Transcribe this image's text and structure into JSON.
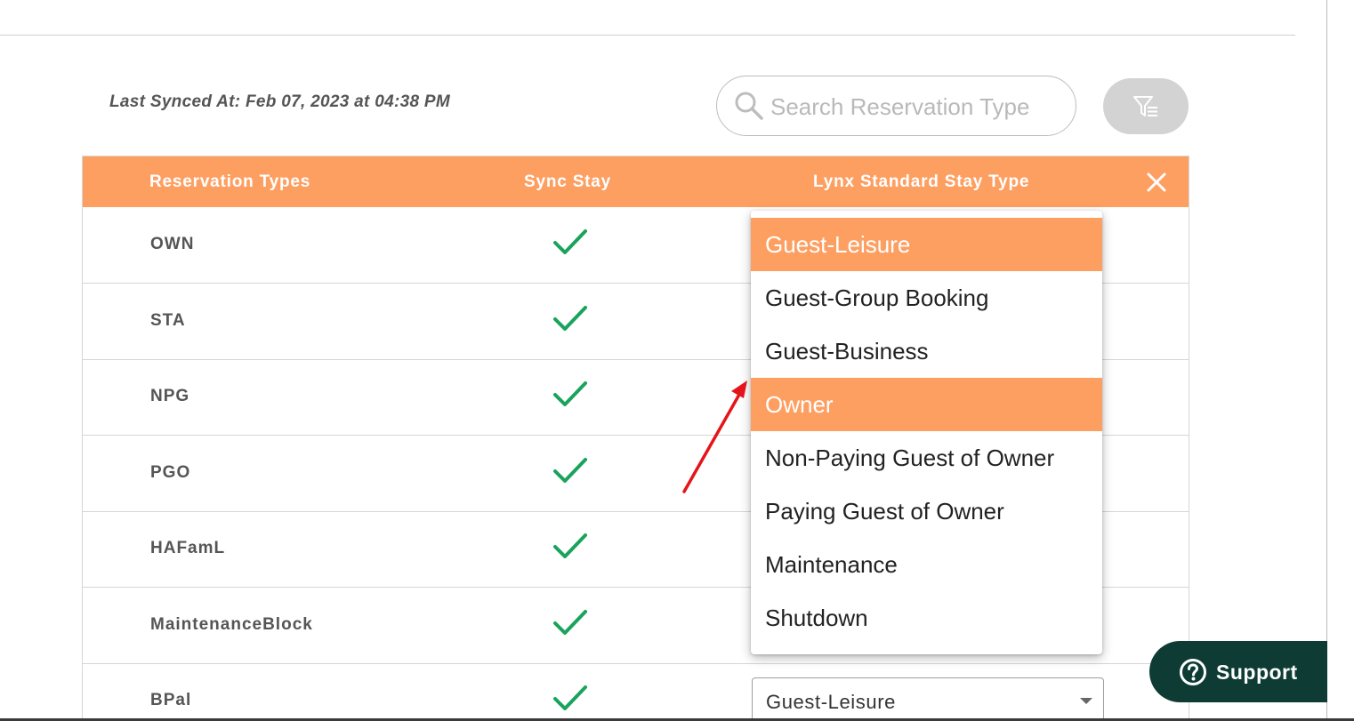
{
  "sync_info": {
    "last_synced": "Last Synced At: Feb 07, 2023 at 04:38 PM"
  },
  "search": {
    "placeholder": "Search Reservation Type",
    "value": ""
  },
  "table": {
    "columns": [
      "Reservation Types",
      "Sync Stay",
      "Lynx Standard Stay Type"
    ],
    "rows": [
      {
        "reservation_type": "OWN",
        "sync_stay": true
      },
      {
        "reservation_type": "STA",
        "sync_stay": true
      },
      {
        "reservation_type": "NPG",
        "sync_stay": true
      },
      {
        "reservation_type": "PGO",
        "sync_stay": true
      },
      {
        "reservation_type": "HAFamL",
        "sync_stay": true
      },
      {
        "reservation_type": "MaintenanceBlock",
        "sync_stay": true
      },
      {
        "reservation_type": "BPal",
        "sync_stay": true,
        "stay_type": "Guest-Leisure"
      }
    ]
  },
  "dropdown": {
    "options": [
      {
        "label": "Guest-Leisure",
        "highlighted": true
      },
      {
        "label": "Guest-Group Booking",
        "highlighted": false
      },
      {
        "label": "Guest-Business",
        "highlighted": false
      },
      {
        "label": "Owner",
        "highlighted": true
      },
      {
        "label": "Non-Paying Guest of Owner",
        "highlighted": false
      },
      {
        "label": "Paying Guest of Owner",
        "highlighted": false
      },
      {
        "label": "Maintenance",
        "highlighted": false
      },
      {
        "label": "Shutdown",
        "highlighted": false
      }
    ]
  },
  "support": {
    "label": "Support"
  },
  "colors": {
    "accent": "#fe9f62",
    "check": "#1aa35c",
    "support_bg": "#0e3c34",
    "annotation_arrow": "#e5141a"
  },
  "icons": [
    "search-icon",
    "filter-icon",
    "close-icon",
    "check-icon",
    "caret-down-icon",
    "help-icon",
    "arrow-annotation"
  ]
}
